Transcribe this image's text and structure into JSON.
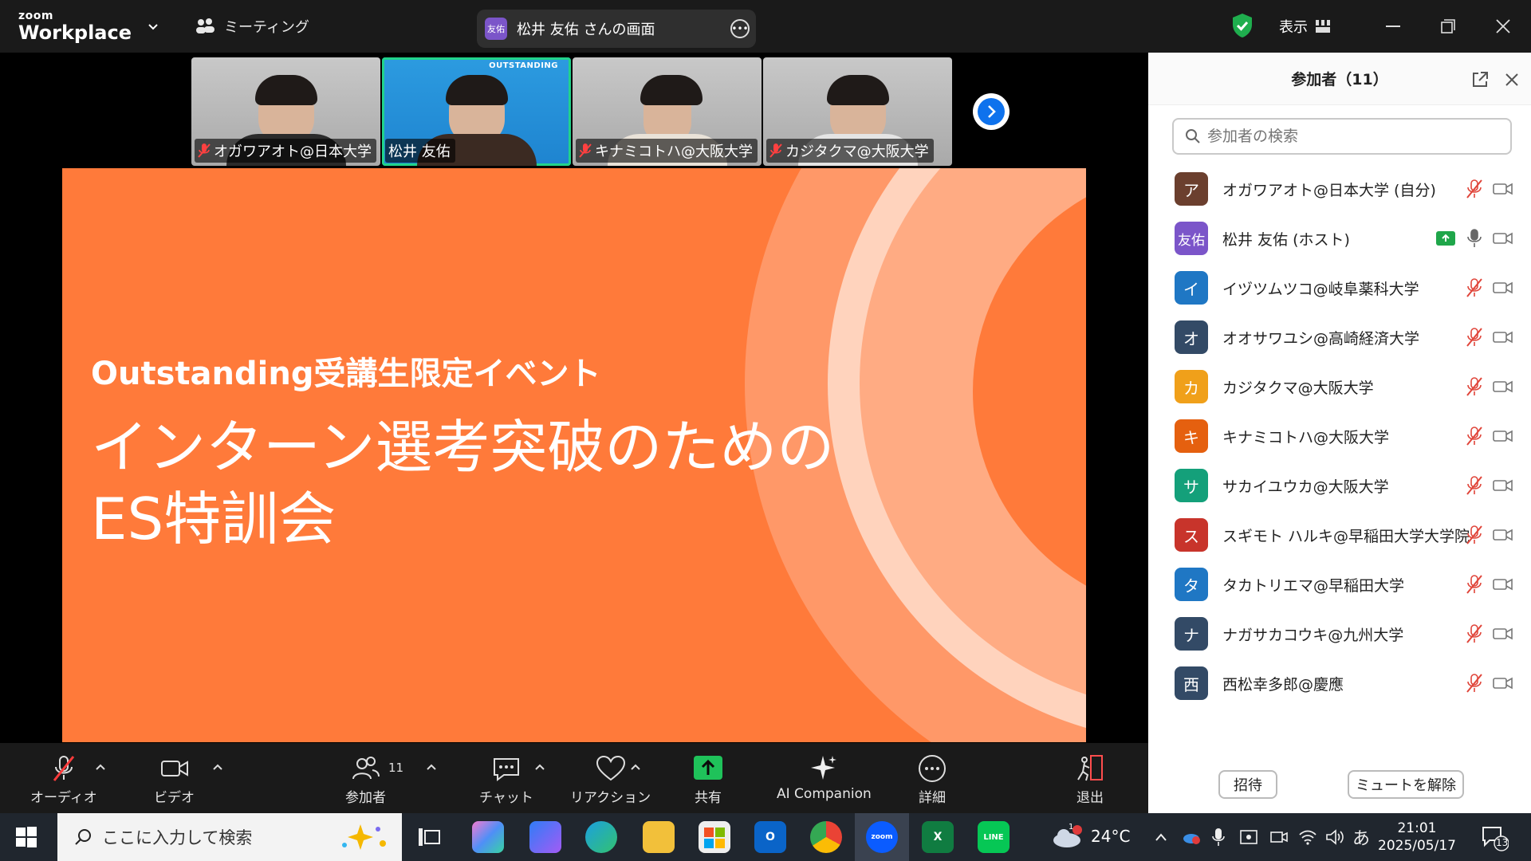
{
  "app": {
    "logo_small": "zoom",
    "logo_big": "Workplace",
    "meeting_menu": "ミーティング",
    "share_banner": {
      "avatar_text": "友佑",
      "text": "松井 友佑 さんの画面"
    },
    "view_label": "表示"
  },
  "video_strip": [
    {
      "name": "オガワアオト@日本大学",
      "muted": true,
      "active": false
    },
    {
      "name": "松井 友佑",
      "muted": false,
      "active": true,
      "brand": "OUTSTANDING"
    },
    {
      "name": "キナミコトハ@大阪大学",
      "muted": true,
      "active": false
    },
    {
      "name": "カジタクマ@大阪大学",
      "muted": true,
      "active": false
    }
  ],
  "slide": {
    "subtitle": "Outstanding受講生限定イベント",
    "title_line1": "インターン選考突破のための",
    "title_line2": "ES特訓会",
    "background_color": "#ff7a3a"
  },
  "toolbar": {
    "audio": "オーディオ",
    "video": "ビデオ",
    "participants": "参加者",
    "participant_count": "11",
    "chat": "チャット",
    "reactions": "リアクション",
    "share": "共有",
    "ai": "AI Companion",
    "more": "詳細",
    "leave": "退出"
  },
  "panel": {
    "title": "参加者（11）",
    "search_placeholder": "参加者の検索",
    "invite": "招待",
    "unmute_all": "ミュートを解除",
    "participants": [
      {
        "avatar": "ア",
        "color": "#6b3f2e",
        "name": "オガワアオト@日本大学 (自分)",
        "muted": true,
        "sharing": false
      },
      {
        "avatar": "友佑",
        "color": "#7b55c9",
        "name": "松井 友佑 (ホスト)",
        "muted": false,
        "sharing": true
      },
      {
        "avatar": "イ",
        "color": "#1f77c4",
        "name": "イヅツムツコ@岐阜薬科大学",
        "muted": true,
        "sharing": false
      },
      {
        "avatar": "オ",
        "color": "#334a66",
        "name": "オオサワユシ@高崎経済大学",
        "muted": true,
        "sharing": false
      },
      {
        "avatar": "カ",
        "color": "#f0a01a",
        "name": "カジタクマ@大阪大学",
        "muted": true,
        "sharing": false
      },
      {
        "avatar": "キ",
        "color": "#e5600f",
        "name": "キナミコトハ@大阪大学",
        "muted": true,
        "sharing": false
      },
      {
        "avatar": "サ",
        "color": "#14a07a",
        "name": "サカイユウカ@大阪大学",
        "muted": true,
        "sharing": false
      },
      {
        "avatar": "ス",
        "color": "#c8342b",
        "name": "スギモト ハルキ@早稲田大学大学院",
        "muted": true,
        "sharing": false
      },
      {
        "avatar": "タ",
        "color": "#1f77c4",
        "name": "タカトリエマ@早稲田大学",
        "muted": true,
        "sharing": false
      },
      {
        "avatar": "ナ",
        "color": "#334a66",
        "name": "ナガサカコウキ@九州大学",
        "muted": true,
        "sharing": false
      },
      {
        "avatar": "西",
        "color": "#334a66",
        "name": "西松幸多郎@慶應",
        "muted": true,
        "sharing": false
      }
    ]
  },
  "taskbar": {
    "search_placeholder": "ここに入力して検索",
    "weather_temp": "24°C",
    "weather_badge": "1",
    "ime": "あ",
    "time": "21:01",
    "date": "2025/05/17",
    "notification_count": "13",
    "apps": [
      "task-view",
      "copilot",
      "bing",
      "edge",
      "file-explorer",
      "store",
      "outlook",
      "chrome",
      "zoom",
      "excel",
      "line"
    ]
  }
}
